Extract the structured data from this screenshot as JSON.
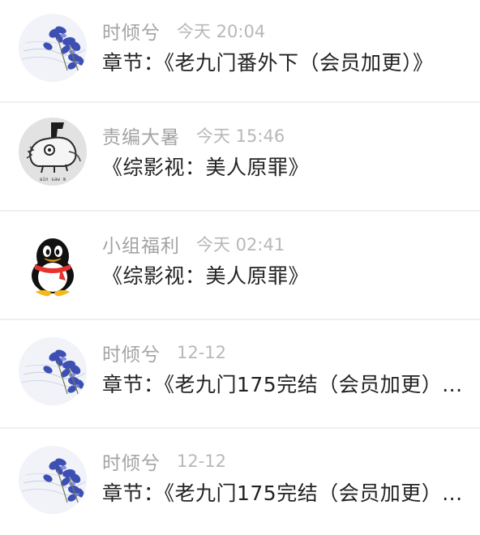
{
  "messages": [
    {
      "avatar_icon": "flower-avatar-icon",
      "name": "时倾兮",
      "time": "今天 20:04",
      "content": "章节：《老九门番外下（会员加更）》"
    },
    {
      "avatar_icon": "sketch-avatar-icon",
      "name": "责编大暑",
      "time": "今天 15:46",
      "content": "《综影视：美人原罪》"
    },
    {
      "avatar_icon": "penguin-avatar-icon",
      "name": "小组福利",
      "time": "今天 02:41",
      "content": "《综影视：美人原罪》"
    },
    {
      "avatar_icon": "flower-avatar-icon",
      "name": "时倾兮",
      "time": "12-12",
      "content": "章节：《老九门175完结（会员加更）..."
    },
    {
      "avatar_icon": "flower-avatar-icon",
      "name": "时倾兮",
      "time": "12-12",
      "content": "章节：《老九门175完结（会员加更）..."
    }
  ],
  "colors": {
    "name_text": "#a3a3a3",
    "time_text": "#b8b8b8",
    "content_text": "#222222",
    "divider": "#efefef",
    "flower_blue": "#3e4fb3",
    "penguin_red": "#e5322d",
    "penguin_yellow": "#f6b91a"
  }
}
